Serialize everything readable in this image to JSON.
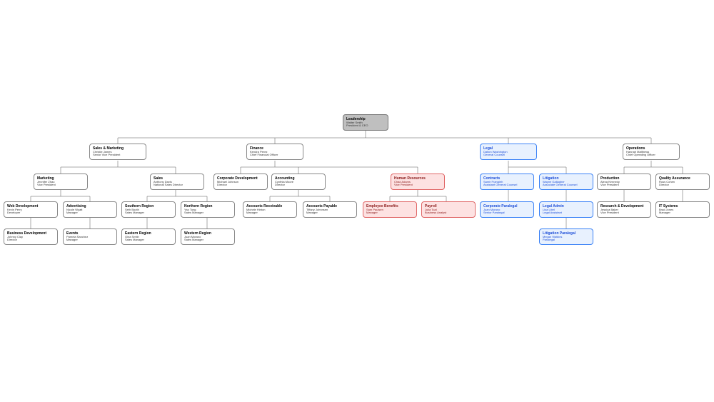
{
  "root": {
    "title": "Leadership",
    "name": "Walter Smith",
    "role": "President & CEO"
  },
  "level2": {
    "sales_marketing": {
      "title": "Sales & Marketing",
      "name": "Christie James",
      "role": "Senior Vice President"
    },
    "finance": {
      "title": "Finance",
      "name": "Kendra Perez",
      "role": "Chief Financial Officer"
    },
    "legal": {
      "title": "Legal",
      "name": "Dalton Washington",
      "role": "General Counsel"
    },
    "operations": {
      "title": "Operations",
      "name": "Hannah Matthews",
      "role": "Chief Operating Officer"
    }
  },
  "level3": {
    "marketing": {
      "title": "Marketing",
      "name": "Jennifer Zhau",
      "role": "Vice President"
    },
    "sales": {
      "title": "Sales",
      "name": "Anthony Davis",
      "role": "National Sales Director"
    },
    "corp_dev": {
      "title": "Corporate Development",
      "name": "Michael Johnson",
      "role": "Director"
    },
    "accounting": {
      "title": "Accounting",
      "name": "Cynthia Moore",
      "role": "Director"
    },
    "hr": {
      "title": "Human Resources",
      "name": "Chad Adams",
      "role": "Vice President"
    },
    "contracts": {
      "title": "Contracts",
      "name": "Samir Frangieh",
      "role": "Assistant General Counsel"
    },
    "litigation": {
      "title": "Litigation",
      "name": "Wayne Gallagher",
      "role": "Associate General Counsel"
    },
    "production": {
      "title": "Production",
      "name": "Alexa Kennedy",
      "role": "Vice President"
    },
    "qa": {
      "title": "Quality Assurance",
      "name": "Russ Cohen",
      "role": "Director"
    }
  },
  "level4": {
    "web_dev": {
      "title": "Web Development",
      "name": "Kevin Perry",
      "role": "Developer"
    },
    "advertising": {
      "title": "Advertising",
      "name": "Nicole Wyatt",
      "role": "Manager"
    },
    "southern": {
      "title": "Southern Region",
      "name": "Seth Booth",
      "role": "Sales Manager"
    },
    "northern": {
      "title": "Northern Region",
      "name": "Yao Tong",
      "role": "Sales Manager"
    },
    "ar": {
      "title": "Accounts Receivable",
      "name": "Michele Hinton",
      "role": "Manager"
    },
    "ap": {
      "title": "Accounts Payable",
      "name": "Tiffany Johnnsen",
      "role": "Manager"
    },
    "benefits": {
      "title": "Employee Benefits",
      "name": "Sam Paulsen",
      "role": "Manager"
    },
    "payroll": {
      "title": "Payroll",
      "name": "Julia Toal",
      "role": "Business Analyst"
    },
    "corp_paralegal": {
      "title": "Corporate Paralegal",
      "name": "Juan Morano",
      "role": "Senior Paralegal"
    },
    "legal_admin": {
      "title": "Legal Admin",
      "name": "Lisa Libel",
      "role": "Legal Assistant"
    },
    "rd": {
      "title": "Research & Development",
      "name": "Jessica Baker",
      "role": "Vice President"
    },
    "it": {
      "title": "IT Systems",
      "name": "Brad Jones",
      "role": "Manager"
    }
  },
  "level5": {
    "biz_dev": {
      "title": "Business Development",
      "name": "Johnny Clay",
      "role": "Director"
    },
    "events": {
      "title": "Events",
      "name": "Pamela Sanchez",
      "role": "Manager"
    },
    "eastern": {
      "title": "Eastern Region",
      "name": "Gina Smith",
      "role": "Sales Manager"
    },
    "western": {
      "title": "Western Region",
      "name": "Juan Morano",
      "role": "Sales Manager"
    },
    "litigation_paralegal": {
      "title": "Litigation Paralegal",
      "name": "Megan Watkins",
      "role": "Paralegal"
    }
  },
  "chart_data": {
    "type": "tree",
    "title": "Organization Chart",
    "root": {
      "title": "Leadership",
      "name": "Walter Smith",
      "role": "President & CEO",
      "children": [
        {
          "title": "Sales & Marketing",
          "name": "Christie James",
          "role": "Senior Vice President",
          "children": [
            {
              "title": "Marketing",
              "name": "Jennifer Zhau",
              "role": "Vice President",
              "children": [
                {
                  "title": "Web Development",
                  "name": "Kevin Perry",
                  "role": "Developer"
                },
                {
                  "title": "Advertising",
                  "name": "Nicole Wyatt",
                  "role": "Manager"
                },
                {
                  "title": "Business Development",
                  "name": "Johnny Clay",
                  "role": "Director"
                },
                {
                  "title": "Events",
                  "name": "Pamela Sanchez",
                  "role": "Manager"
                }
              ]
            },
            {
              "title": "Sales",
              "name": "Anthony Davis",
              "role": "National Sales Director",
              "children": [
                {
                  "title": "Southern Region",
                  "name": "Seth Booth",
                  "role": "Sales Manager"
                },
                {
                  "title": "Northern Region",
                  "name": "Yao Tong",
                  "role": "Sales Manager"
                },
                {
                  "title": "Eastern Region",
                  "name": "Gina Smith",
                  "role": "Sales Manager"
                },
                {
                  "title": "Western Region",
                  "name": "Juan Morano",
                  "role": "Sales Manager"
                }
              ]
            }
          ]
        },
        {
          "title": "Finance",
          "name": "Kendra Perez",
          "role": "Chief Financial Officer",
          "children": [
            {
              "title": "Corporate Development",
              "name": "Michael Johnson",
              "role": "Director"
            },
            {
              "title": "Accounting",
              "name": "Cynthia Moore",
              "role": "Director",
              "children": [
                {
                  "title": "Accounts Receivable",
                  "name": "Michele Hinton",
                  "role": "Manager"
                },
                {
                  "title": "Accounts Payable",
                  "name": "Tiffany Johnnsen",
                  "role": "Manager"
                }
              ]
            },
            {
              "title": "Human Resources",
              "name": "Chad Adams",
              "role": "Vice President",
              "highlight": "red",
              "children": [
                {
                  "title": "Employee Benefits",
                  "name": "Sam Paulsen",
                  "role": "Manager",
                  "highlight": "red"
                },
                {
                  "title": "Payroll",
                  "name": "Julia Toal",
                  "role": "Business Analyst",
                  "highlight": "red"
                }
              ]
            }
          ]
        },
        {
          "title": "Legal",
          "name": "Dalton Washington",
          "role": "General Counsel",
          "highlight": "blue",
          "children": [
            {
              "title": "Contracts",
              "name": "Samir Frangieh",
              "role": "Assistant General Counsel",
              "highlight": "blue",
              "children": [
                {
                  "title": "Corporate Paralegal",
                  "name": "Juan Morano",
                  "role": "Senior Paralegal",
                  "highlight": "blue"
                }
              ]
            },
            {
              "title": "Litigation",
              "name": "Wayne Gallagher",
              "role": "Associate General Counsel",
              "highlight": "blue",
              "children": [
                {
                  "title": "Legal Admin",
                  "name": "Lisa Libel",
                  "role": "Legal Assistant",
                  "highlight": "blue"
                },
                {
                  "title": "Litigation Paralegal",
                  "name": "Megan Watkins",
                  "role": "Paralegal",
                  "highlight": "blue"
                }
              ]
            }
          ]
        },
        {
          "title": "Operations",
          "name": "Hannah Matthews",
          "role": "Chief Operating Officer",
          "children": [
            {
              "title": "Production",
              "name": "Alexa Kennedy",
              "role": "Vice President",
              "children": [
                {
                  "title": "Research & Development",
                  "name": "Jessica Baker",
                  "role": "Vice President"
                }
              ]
            },
            {
              "title": "Quality Assurance",
              "name": "Russ Cohen",
              "role": "Director",
              "children": [
                {
                  "title": "IT Systems",
                  "name": "Brad Jones",
                  "role": "Manager"
                }
              ]
            }
          ]
        }
      ]
    }
  }
}
